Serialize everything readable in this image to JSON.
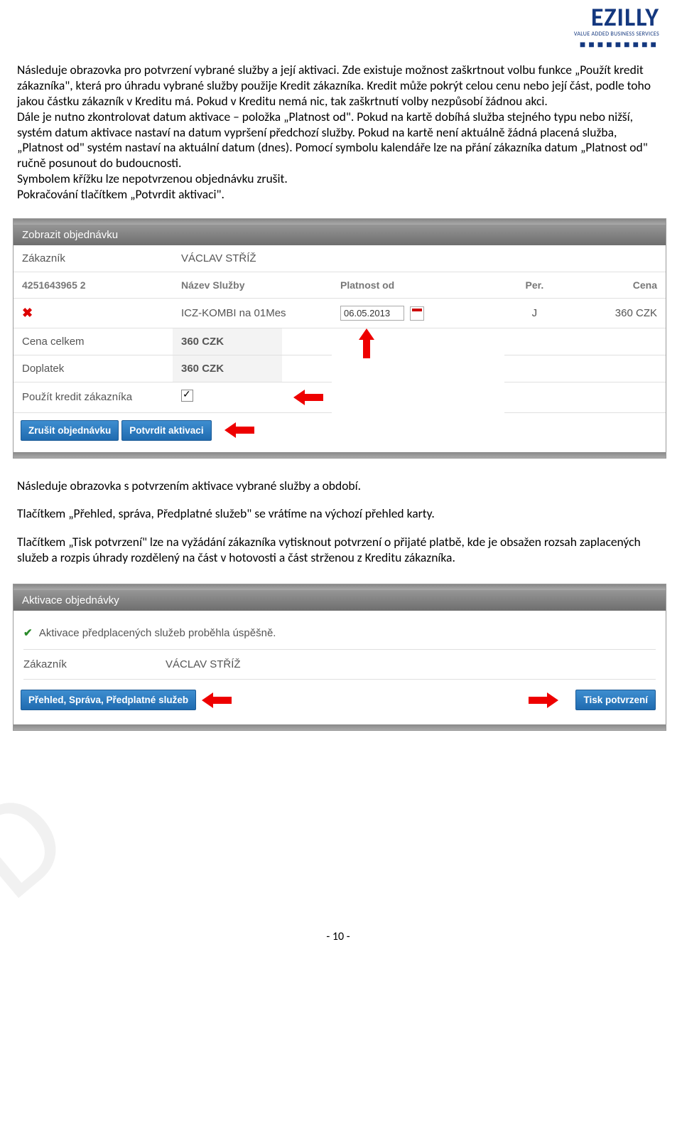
{
  "logo": {
    "title": "EZILLY",
    "subtitle": "VALUE ADDED BUSINESS SERVICES"
  },
  "para1": "Následuje obrazovka pro potvrzení vybrané služby a její aktivaci. Zde existuje možnost zaškrtnout volbu funkce „Použít kredit zákazníka\", která pro úhradu vybrané služby použije Kredit zákazníka. Kredit může pokrýt celou cenu nebo její část, podle toho jakou částku zákazník v Kreditu má. Pokud v Kreditu nemá nic, tak zaškrtnutí volby nezpůsobí žádnou akci.",
  "para2": "Dále je nutno zkontrolovat datum aktivace – položka „Platnost od\". Pokud na kartě dobíhá služba stejného typu nebo nižší, systém datum aktivace nastaví na datum vypršení předchozí služby. Pokud na kartě není aktuálně žádná placená služba, „Platnost od\" systém nastaví na aktuální datum (dnes). Pomocí symbolu kalendáře lze na přání zákazníka datum „Platnost od\" ručně posunout do budoucnosti.",
  "para3": "Symbolem křížku lze nepotvrzenou objednávku zrušit.",
  "para4": "Pokračování tlačítkem „Potvrdit aktivaci\".",
  "ss1": {
    "title": "Zobrazit objednávku",
    "customer_label": "Zákazník",
    "customer_value": "VÁCLAV STŘÍŽ",
    "card_id": "4251643965 2",
    "h_service": "Název Služby",
    "h_valid_from": "Platnost od",
    "h_period": "Per.",
    "h_price": "Cena",
    "service_name": "ICZ-KOMBI na 01Mes",
    "valid_from": "06.05.2013",
    "period": "J",
    "price": "360 CZK",
    "total_label": "Cena celkem",
    "total_value": "360 CZK",
    "surcharge_label": "Doplatek",
    "surcharge_value": "360 CZK",
    "use_credit_label": "Použít kredit zákazníka",
    "btn_cancel": "Zrušit objednávku",
    "btn_confirm": "Potvrdit aktivaci"
  },
  "para5": "Následuje obrazovka s potvrzením aktivace vybrané služby a období.",
  "para6": "Tlačítkem „Přehled, správa, Předplatné služeb\" se vrátíme na výchozí přehled karty.",
  "para7": "Tlačítkem „Tisk potvrzení\" lze na vyžádání zákazníka vytisknout potvrzení o přijaté platbě, kde je obsažen rozsah zaplacených služeb a rozpis úhrady rozdělený na část v hotovosti a část strženou z Kreditu zákazníka.",
  "ss2": {
    "title": "Aktivace objednávky",
    "success_msg": "Aktivace předplacených služeb proběhla úspěšně.",
    "customer_label": "Zákazník",
    "customer_value": "VÁCLAV STŘÍŽ",
    "btn_overview": "Přehled, Správa, Předplatné služeb",
    "btn_print": "Tisk potvrzení"
  },
  "footer": "- 10 -"
}
